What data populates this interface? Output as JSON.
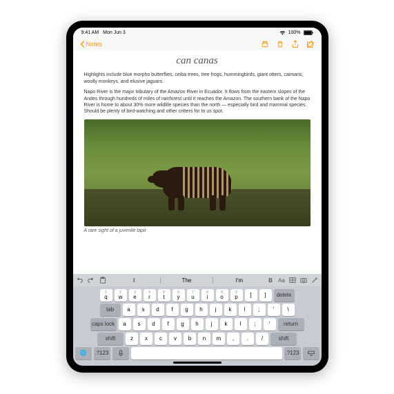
{
  "status": {
    "time": "9:41 AM",
    "date": "Mon Jun 3",
    "wifi": "wifi",
    "battery": "100%"
  },
  "nav": {
    "back": "Notes"
  },
  "note": {
    "title": "can canas",
    "para1": "Highlights include blue morpho butterflies, ceiba trees, tree frogs, hummingbirds, giant otters, caimans, woolly monkeys, and elusive jaguars.",
    "para2": "Napo River is the major tributary of the Amazon River in Ecuador. It flows from the eastern slopes of the Andes through hundreds of miles of rainforest until it reaches the Amazon. The southern bank of the Napo River is home to about 30% more wildlife species than the north — especially bird and mammal species. Should be plenty of bird-watching and other critters for to us spot.",
    "caption": "A rare sight of a juvenile tapir"
  },
  "suggestions": {
    "w1": "I",
    "w2": "The",
    "w3": "I'm",
    "aa": "Aa"
  },
  "keys": {
    "row1": [
      [
        "1",
        "q"
      ],
      [
        "2",
        "w"
      ],
      [
        "3",
        "e"
      ],
      [
        "4",
        "r"
      ],
      [
        "5",
        "t"
      ],
      [
        "6",
        "y"
      ],
      [
        "7",
        "u"
      ],
      [
        "8",
        "i"
      ],
      [
        "9",
        "o"
      ],
      [
        "0",
        "p"
      ],
      [
        "",
        "["
      ],
      [
        "",
        "]"
      ]
    ],
    "row2": [
      [
        "a"
      ],
      [
        "s"
      ],
      [
        "d"
      ],
      [
        "f"
      ],
      [
        "g"
      ],
      [
        "h"
      ],
      [
        "j"
      ],
      [
        "k"
      ],
      [
        "l"
      ],
      [
        ";"
      ],
      [
        "'"
      ],
      [
        "\\"
      ]
    ],
    "row3": [
      [
        "z"
      ],
      [
        "x"
      ],
      [
        "c"
      ],
      [
        "v"
      ],
      [
        "b"
      ],
      [
        "n"
      ],
      [
        "m"
      ],
      [
        ","
      ],
      [
        "."
      ],
      [
        "/"
      ]
    ],
    "tab": "tab",
    "caps": "caps lock",
    "shift": "shift",
    "delete": "delete",
    "return": "return",
    "globe": "🌐",
    "mic": "mic",
    "numkey": ".?123"
  },
  "image": {
    "alt": "juvenile tapir with striped coat standing in forest clearing"
  }
}
